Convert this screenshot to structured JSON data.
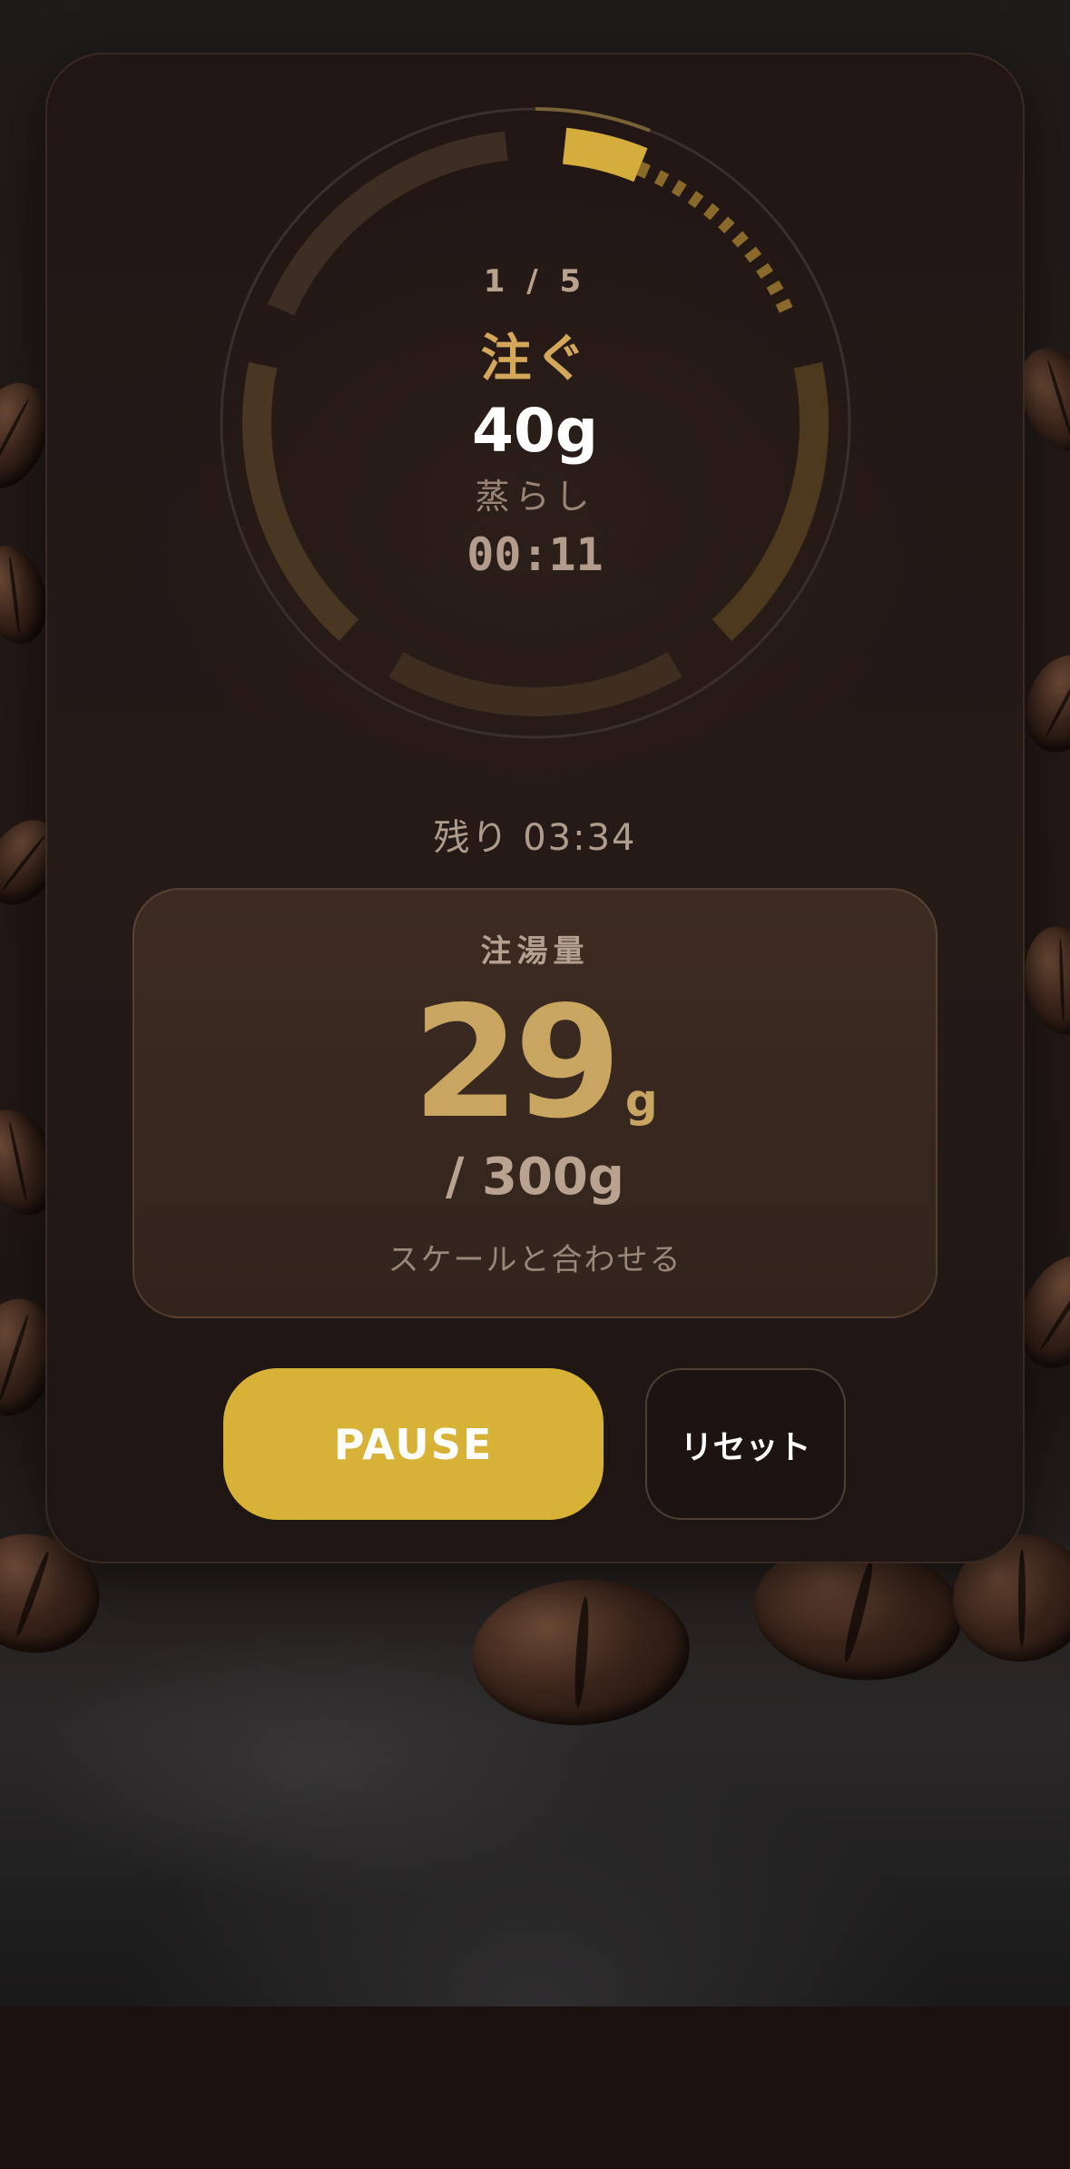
{
  "colors": {
    "accent": "#d7b236",
    "ring_active": "#d4ad3c",
    "ring_pending": "#4a3522",
    "water_value": "#c9a562",
    "background": "#1b1210"
  },
  "timer": {
    "step_count": "1 / 5",
    "step_action": "注ぐ",
    "step_target": "40g",
    "step_name": "蒸らし",
    "step_elapsed": "00:11",
    "step_progress": 0.27
  },
  "remaining": {
    "text": "残り 03:34"
  },
  "water": {
    "label": "注湯量",
    "value": "29",
    "unit": "g",
    "target": "/ 300g",
    "hint": "スケールと合わせる"
  },
  "controls": {
    "pause_label": "PAUSE",
    "reset_label": "リセット"
  }
}
